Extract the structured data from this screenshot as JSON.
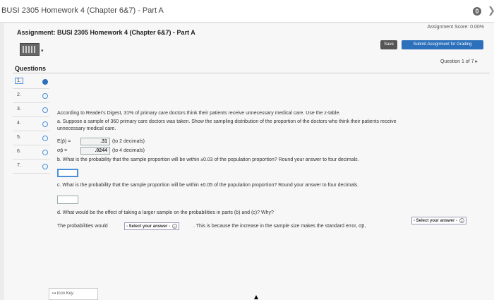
{
  "window": {
    "title": "BUSI 2305 Homework 4 (Chapter 6&7) - Part A",
    "info_label": "0",
    "next_label": "❯"
  },
  "assignment": {
    "title": "Assignment: BUSI 2305 Homework 4 (Chapter 6&7) - Part A",
    "score_label": "Assignment Score: 0.00%"
  },
  "toolbar": {
    "save_label": "Save",
    "submit_label": "Submit Assignment for Grading"
  },
  "sidebar": {
    "heading": "Questions",
    "counter": "Question 1 of 7 ▸",
    "items": [
      {
        "num": "1.",
        "status": "filled"
      },
      {
        "num": "2.",
        "status": "empty"
      },
      {
        "num": "3.",
        "status": "empty"
      },
      {
        "num": "4.",
        "status": "empty"
      },
      {
        "num": "5.",
        "status": "empty"
      },
      {
        "num": "6.",
        "status": "empty"
      },
      {
        "num": "7.",
        "status": "empty"
      }
    ]
  },
  "question": {
    "intro": "According to Reader's Digest, 31% of primary care doctors think their patients receive unnecessary medical care. Use the z-table.",
    "part_a_line1": "a. Suppose a sample of 360 primary care doctors was taken. Show the sampling distribution of the proportion of the doctors who think their patients receive",
    "part_a_line2": "unnecessary medical care.",
    "ep_label": "E(p̄) =",
    "ep_value": ".31",
    "ep_hint": "(to 2 decimals)",
    "sigma_label": "σp̄ =",
    "sigma_value": ".0244",
    "sigma_hint": "(to 4 decimals)",
    "part_b": "b. What is the probability that the sample proportion will be within ±0.03 of the population proportion? Round your answer to four decimals.",
    "part_c": "c. What is the probability that the sample proportion will be within ±0.05 of the population proportion? Round your answer to four decimals.",
    "part_d": "d. What would be the effect of taking a larger sample on the probabilities in parts (b) and (c)? Why?",
    "part_d_prefix": "The probabilities would",
    "part_d_select1": "- Select your answer -",
    "part_d_middle": ". This is because the increase in the sample size makes the standard error, σp̄,",
    "part_d_select2": "- Select your answer -"
  },
  "footer": {
    "icon_key": "Icon Key"
  },
  "colors": {
    "accent": "#2c6fbb",
    "save_button": "#555555"
  }
}
